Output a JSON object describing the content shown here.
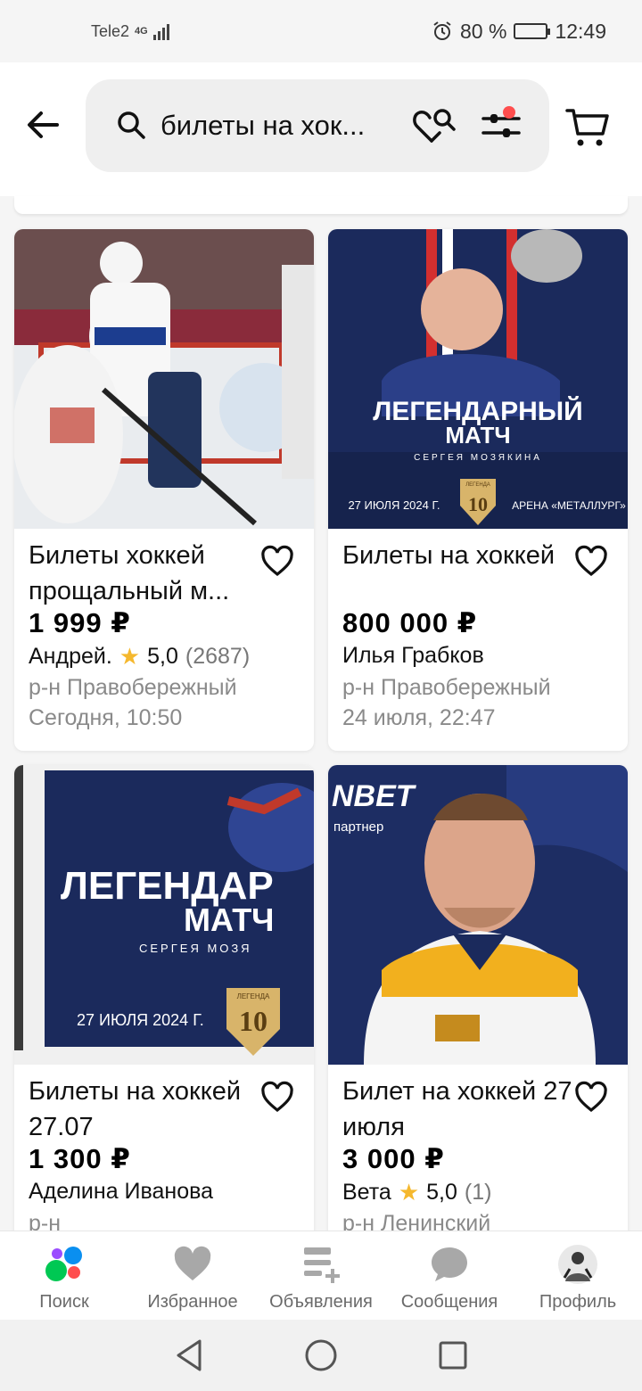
{
  "status_bar": {
    "carrier": "Tele2",
    "network": "4G",
    "battery_text": "80 %",
    "battery_level": 0.8,
    "time": "12:49"
  },
  "header": {
    "search_query": "билеты на хок...",
    "filter_badge_color": "#ff4e4e"
  },
  "listings": [
    {
      "title": "Билеты хоккей прощальный м...",
      "price": "1 999 ₽",
      "seller": "Андрей.",
      "rating": "5,0",
      "reviews": "(2687)",
      "district": "р-н Правобережный",
      "date": "Сегодня, 10:50"
    },
    {
      "title": "Билеты на хоккей",
      "price": "800 000 ₽",
      "seller": "Илья Грабков",
      "district": "р-н Правобережный",
      "date": "24 июля, 22:47",
      "poster": {
        "line1": "ЛЕГЕНДАРНЫЙ",
        "line2": "МАТЧ",
        "subtitle": "СЕРГЕЯ МОЗЯКИНА",
        "date": "27 ИЮЛЯ 2024 Г.",
        "arena": "АРЕНА «МЕТАЛЛУРГ»",
        "badge_number": "10",
        "badge_text": "ЛЕГЕНДА"
      }
    },
    {
      "title": "Билеты на хоккей 27.07",
      "price": "1 300 ₽",
      "seller": "Аделина Иванова",
      "district": "р-н",
      "poster": {
        "line1": "ЛЕГЕНДАР",
        "line2": "МАТЧ",
        "subtitle": "СЕРГЕЯ МОЗЯ",
        "date": "27 ИЮЛЯ 2024 Г.",
        "badge_number": "10",
        "badge_text": "ЛЕГЕНДА"
      }
    },
    {
      "title": "Билет на хоккей 27 июля",
      "price": "3 000 ₽",
      "seller": "Вета",
      "rating": "5,0",
      "reviews": "(1)",
      "district": "р-н Ленинский",
      "photo_text": {
        "brand": "NBET",
        "partner": "партнер"
      }
    }
  ],
  "bottom_nav": [
    {
      "label": "Поиск",
      "icon": "search-dots-icon",
      "active": true
    },
    {
      "label": "Избранное",
      "icon": "heart-icon"
    },
    {
      "label": "Объявления",
      "icon": "listings-add-icon"
    },
    {
      "label": "Сообщения",
      "icon": "chat-bubble-icon"
    },
    {
      "label": "Профиль",
      "icon": "profile-avatar-icon"
    }
  ],
  "system_nav": [
    "back-triangle-icon",
    "home-circle-icon",
    "recents-square-icon"
  ],
  "colors": {
    "accent_blue": "#0a8ff0",
    "accent_green": "#00c853",
    "accent_purple": "#9b4dff",
    "accent_red": "#ff4e4e",
    "star": "#f5b82e",
    "muted_text": "#8a8a8a"
  }
}
